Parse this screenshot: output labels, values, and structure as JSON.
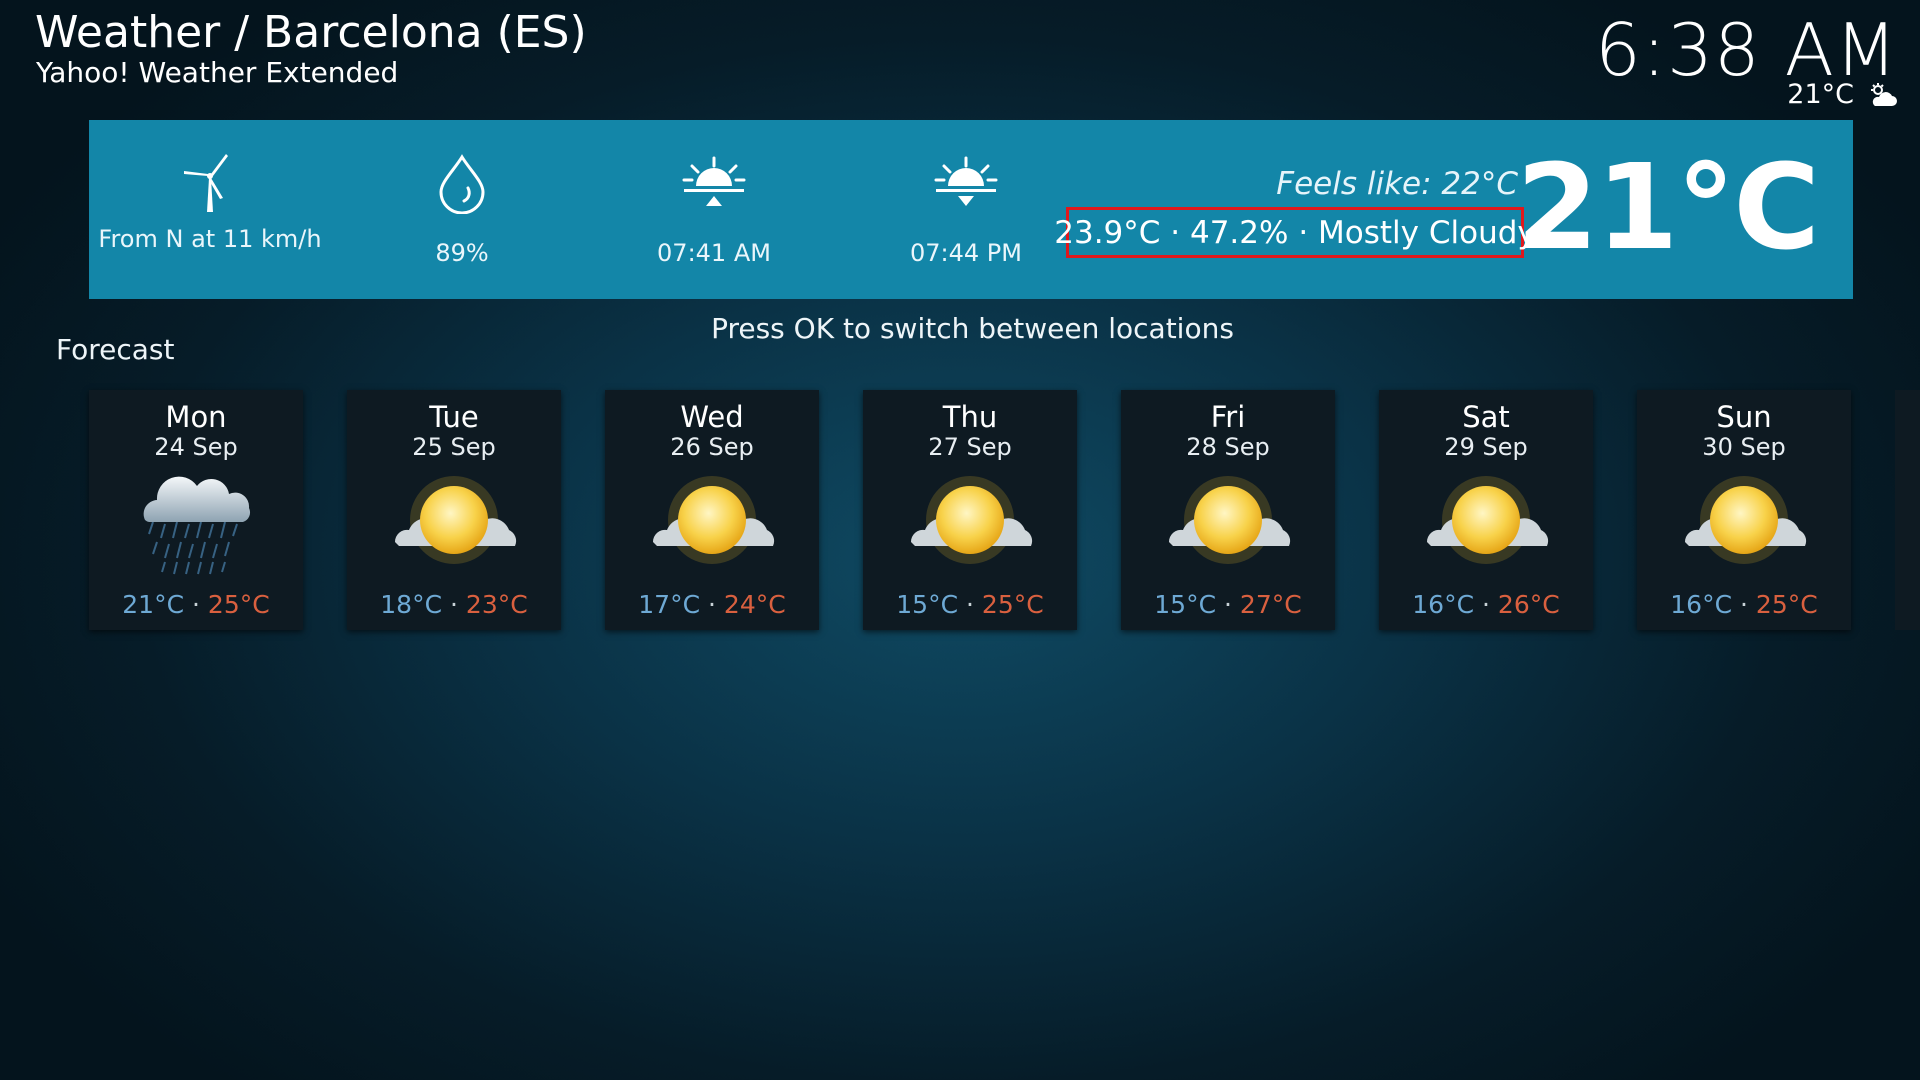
{
  "header": {
    "title": "Weather / Barcelona (ES)",
    "subtitle": "Yahoo! Weather Extended",
    "clock": "6:38 AM",
    "temp": "21°C",
    "icon": "partly-cloudy-icon"
  },
  "current": {
    "wind": "From N at 11 km/h",
    "humidity": "89%",
    "sunrise": "07:41 AM",
    "sunset": "07:44 PM",
    "feels_like": "Feels like: 22°C",
    "details": "23.9°C · 47.2% · Mostly Cloudy",
    "temperature": "21°C",
    "icons": [
      "wind-turbine-icon",
      "humidity-drop-icon",
      "sunrise-icon",
      "sunset-icon"
    ]
  },
  "hint": "Press OK to switch between locations",
  "forecast": {
    "label": "Forecast",
    "separator": "·",
    "days": [
      {
        "day": "Mon",
        "date": "24 Sep",
        "low": "21°C",
        "high": "25°C",
        "icon": "rain-cloud-icon"
      },
      {
        "day": "Tue",
        "date": "25 Sep",
        "low": "18°C",
        "high": "23°C",
        "icon": "sun-cloud-icon"
      },
      {
        "day": "Wed",
        "date": "26 Sep",
        "low": "17°C",
        "high": "24°C",
        "icon": "sun-cloud-icon"
      },
      {
        "day": "Thu",
        "date": "27 Sep",
        "low": "15°C",
        "high": "25°C",
        "icon": "sun-cloud-icon"
      },
      {
        "day": "Fri",
        "date": "28 Sep",
        "low": "15°C",
        "high": "27°C",
        "icon": "sun-cloud-icon"
      },
      {
        "day": "Sat",
        "date": "29 Sep",
        "low": "16°C",
        "high": "26°C",
        "icon": "sun-cloud-icon"
      },
      {
        "day": "Sun",
        "date": "30 Sep",
        "low": "16°C",
        "high": "25°C",
        "icon": "sun-cloud-icon"
      }
    ]
  },
  "colors": {
    "info_bar": "#1386a8",
    "highlight_border": "#e0181c",
    "low_temp": "#6ea9d4",
    "high_temp": "#d9603f"
  }
}
